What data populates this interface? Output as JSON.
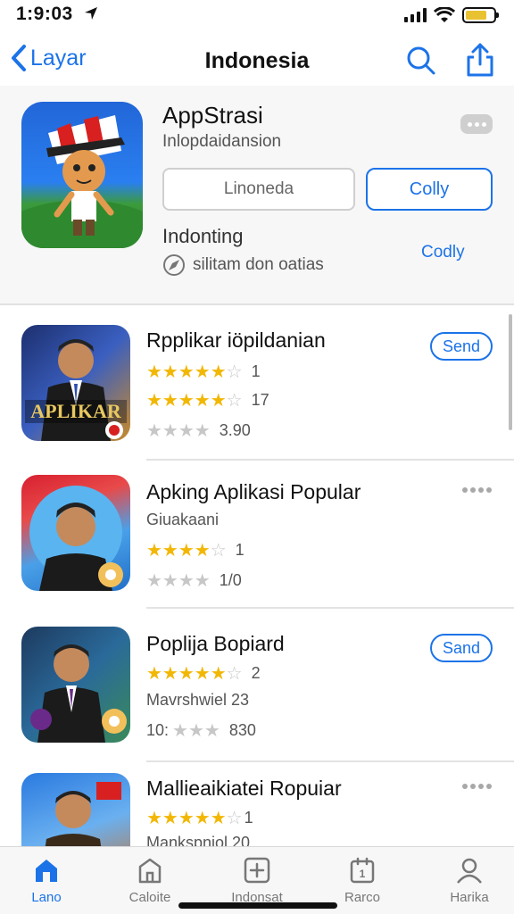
{
  "status": {
    "time": "1:9:03"
  },
  "nav": {
    "back_label": "Layar",
    "title": "Indonesia"
  },
  "hero": {
    "title": "AppStrasi",
    "subtitle": "Inlopdaidansion",
    "input_value": "Linoneda",
    "button_label": "Colly",
    "label": "Indonting",
    "link_label": "Codly",
    "note": "silitam don oatias"
  },
  "apps": [
    {
      "title": "Rpplikar iöpildanian",
      "subtitle": "",
      "ratings": [
        {
          "stars": 4,
          "count": "1"
        },
        {
          "stars": 4,
          "count": "17"
        },
        {
          "stars": 0,
          "count": "3.90"
        }
      ],
      "action": "Send",
      "thumb_text": "APLIKAR"
    },
    {
      "title": "Apking Aplikasi Popular",
      "subtitle": "Giuakaani",
      "ratings": [
        {
          "stars": 4,
          "count": "1"
        },
        {
          "stars": 0,
          "count": "1/0"
        }
      ],
      "action": "",
      "thumb_text": ""
    },
    {
      "title": "Poplija Bopiard",
      "subtitle": "Mavrshwiel 23",
      "ratings": [
        {
          "stars": 4,
          "count": "2"
        },
        {
          "stars": 0,
          "prefix": "10:",
          "count": "830"
        }
      ],
      "action": "Sand",
      "thumb_text": ""
    },
    {
      "title": "Mallieaikiatei Ropuiar",
      "subtitle": "Mankspniol 20",
      "ratings": [
        {
          "stars": 4,
          "count": "1"
        }
      ],
      "action": "",
      "thumb_text": ""
    }
  ],
  "tabs": [
    {
      "label": "Lano",
      "icon": "home-icon"
    },
    {
      "label": "Caloite",
      "icon": "building-icon"
    },
    {
      "label": "Indonsat",
      "icon": "add-box-icon"
    },
    {
      "label": "Rarco",
      "icon": "calendar-icon"
    },
    {
      "label": "Harika",
      "icon": "person-icon"
    }
  ],
  "colors": {
    "accent": "#1c73e8",
    "star": "#f2b705",
    "star_off": "#c7c7c7"
  }
}
